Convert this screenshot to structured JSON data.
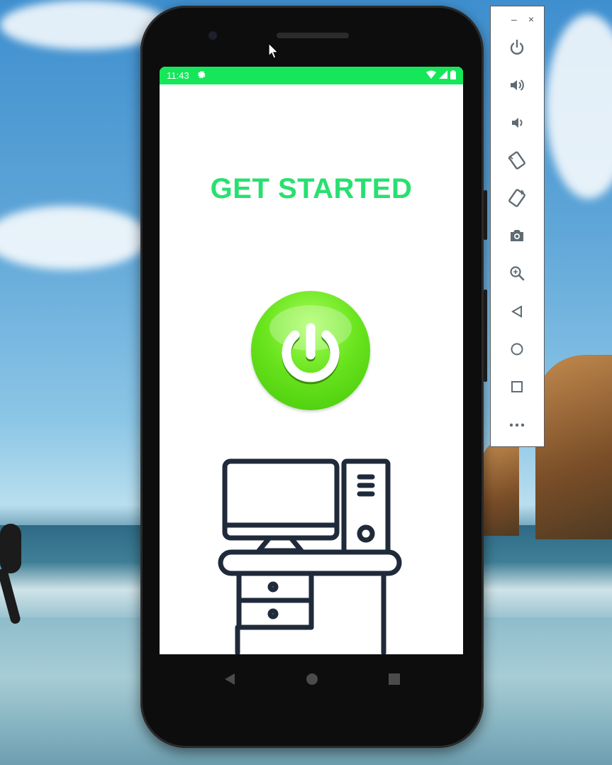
{
  "status_bar": {
    "time": "11:43",
    "gear_icon": "gear-icon",
    "wifi_icon": "wifi-icon",
    "signal_icon": "signal-icon",
    "battery_icon": "battery-icon"
  },
  "app": {
    "title": "GET STARTED",
    "power_icon": "power-icon",
    "illustration": "desk-computer-illustration",
    "title_color": "#28e070",
    "accent_color": "#16e65a"
  },
  "nav_bar": {
    "back": "back-icon",
    "home": "home-icon",
    "recents": "recents-icon"
  },
  "emulator_toolbar": {
    "minimize": "–",
    "close": "×",
    "buttons": [
      "power",
      "volume-up",
      "volume-down",
      "rotate-left",
      "rotate-right",
      "screenshot",
      "zoom",
      "back",
      "home",
      "overview",
      "more"
    ]
  }
}
